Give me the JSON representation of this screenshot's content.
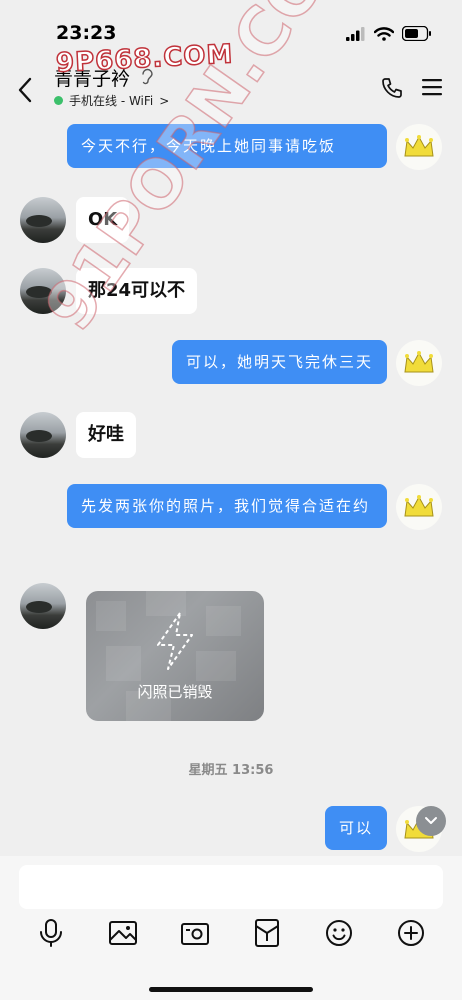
{
  "status_bar": {
    "time": "23:23"
  },
  "watermarks": {
    "top": "9P668.COM",
    "diagonal": "91PORN.COM"
  },
  "header": {
    "contact_name": "青青子衿",
    "presence_text": "手机在线 - WiFi",
    "presence_chevron": ">",
    "icons": [
      "back-chevron-icon",
      "hearing-icon",
      "phone-icon",
      "menu-icon"
    ]
  },
  "messages": [
    {
      "side": "right",
      "text": "今天不行，今天晚上她同事请吃饭"
    },
    {
      "side": "left",
      "text": "OK"
    },
    {
      "side": "left",
      "text": "那24可以不"
    },
    {
      "side": "right",
      "text": "可以，她明天飞完休三天"
    },
    {
      "side": "left",
      "text": "好哇"
    },
    {
      "side": "right",
      "text": "先发两张你的照片，我们觉得合适在约"
    },
    {
      "side": "left",
      "type": "flash_photo",
      "text": "闪照已销毁"
    },
    {
      "type": "timestamp",
      "text": "星期五 13:56"
    },
    {
      "side": "right",
      "text": "可以"
    }
  ],
  "input": {
    "value": "",
    "placeholder": ""
  },
  "toolbar": [
    "microphone-icon",
    "image-icon",
    "camera-icon",
    "red-packet-icon",
    "emoji-icon",
    "plus-icon"
  ],
  "colors": {
    "bubble_right": "#3f8ef4",
    "bubble_left": "#ffffff",
    "background": "#efefef",
    "online_dot": "#3cc06b"
  }
}
